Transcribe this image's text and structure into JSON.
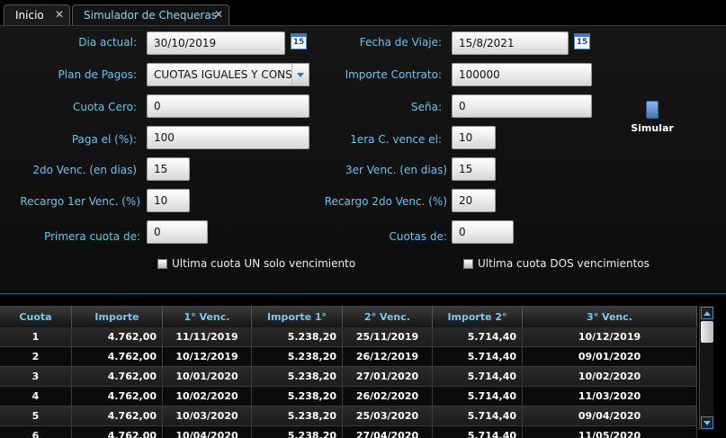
{
  "tabs": [
    {
      "label": "Inicio",
      "close": "✕"
    },
    {
      "label": "Simulador de Chequeras",
      "close": "✕"
    }
  ],
  "form": {
    "dia_actual": {
      "label": "Dia actual:",
      "value": "30/10/2019"
    },
    "fecha_viaje": {
      "label": "Fecha de Viaje:",
      "value": "15/8/2021"
    },
    "plan_pagos": {
      "label": "Plan de Pagos:",
      "value": "CUOTAS IGUALES Y CONSECUTIVAS"
    },
    "importe_contrato": {
      "label": "Importe Contrato:",
      "value": "100000"
    },
    "cuota_cero": {
      "label": "Cuota Cero:",
      "value": "0"
    },
    "sena": {
      "label": "Seña:",
      "value": "0"
    },
    "paga_el": {
      "label": "Paga el (%):",
      "value": "100"
    },
    "primera_vence": {
      "label": "1era C. vence el:",
      "value": "10"
    },
    "segundo_venc": {
      "label": "2do Venc. (en dias)",
      "value": "15"
    },
    "tercer_venc": {
      "label": "3er Venc. (en dias)",
      "value": "15"
    },
    "recargo1": {
      "label": "Recargo 1er Venc. (%)",
      "value": "10"
    },
    "recargo2": {
      "label": "Recargo 2do Venc. (%)",
      "value": "20"
    },
    "primera_cuota": {
      "label": "Primera cuota de:",
      "value": "0"
    },
    "cuotas": {
      "label": "Cuotas de:",
      "value": "0"
    },
    "chk_un": "Ultima cuota UN solo vencimiento",
    "chk_dos": "Ultima cuota DOS vencimientos",
    "cal_icon_text": "15",
    "simular": "Simular"
  },
  "table": {
    "headers": [
      "Cuota",
      "Importe",
      "1° Venc.",
      "Importe 1°",
      "2° Venc.",
      "Importe 2°",
      "3° Venc."
    ],
    "rows": [
      [
        "1",
        "4.762,00",
        "11/11/2019",
        "5.238,20",
        "25/11/2019",
        "5.714,40",
        "10/12/2019"
      ],
      [
        "2",
        "4.762,00",
        "10/12/2019",
        "5.238,20",
        "26/12/2019",
        "5.714,40",
        "09/01/2020"
      ],
      [
        "3",
        "4.762,00",
        "10/01/2020",
        "5.238,20",
        "27/01/2020",
        "5.714,40",
        "10/02/2020"
      ],
      [
        "4",
        "4.762,00",
        "10/02/2020",
        "5.238,20",
        "26/02/2020",
        "5.714,40",
        "11/03/2020"
      ],
      [
        "5",
        "4.762,00",
        "10/03/2020",
        "5.238,20",
        "25/03/2020",
        "5.714,40",
        "09/04/2020"
      ],
      [
        "6",
        "4.762,00",
        "10/04/2020",
        "5.238,20",
        "27/04/2020",
        "5.714,40",
        "11/05/2020"
      ]
    ]
  }
}
